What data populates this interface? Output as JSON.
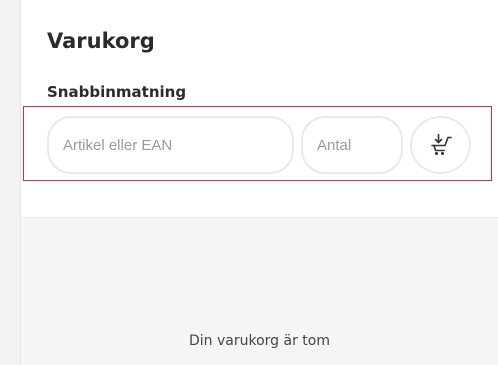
{
  "cart": {
    "title": "Varukorg",
    "quick_entry": {
      "label": "Snabbinmatning",
      "article_placeholder": "Artikel eller EAN",
      "quantity_placeholder": "Antal",
      "add_icon": "cart-add-icon"
    },
    "empty_message": "Din varukorg är tom"
  },
  "colors": {
    "highlight_border": "#e32b3a",
    "field_border": "#e9e9e9",
    "cart_background": "#f5f5f5"
  }
}
